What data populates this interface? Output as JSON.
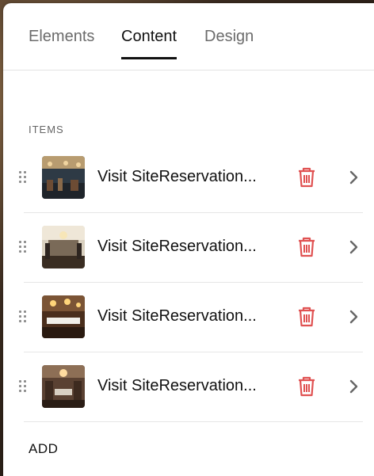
{
  "tabs": [
    {
      "label": "Elements",
      "active": false
    },
    {
      "label": "Content",
      "active": true
    },
    {
      "label": "Design",
      "active": false
    }
  ],
  "section": {
    "label": "ITEMS"
  },
  "items": [
    {
      "title": "Visit SiteReservation..."
    },
    {
      "title": "Visit SiteReservation..."
    },
    {
      "title": "Visit SiteReservation..."
    },
    {
      "title": "Visit SiteReservation..."
    }
  ],
  "add_label": "ADD",
  "colors": {
    "trash": "#e05252",
    "chevron": "#666666"
  },
  "icons": {
    "drag": "drag-handle-icon",
    "trash": "trash-icon",
    "chevron": "chevron-right-icon"
  }
}
